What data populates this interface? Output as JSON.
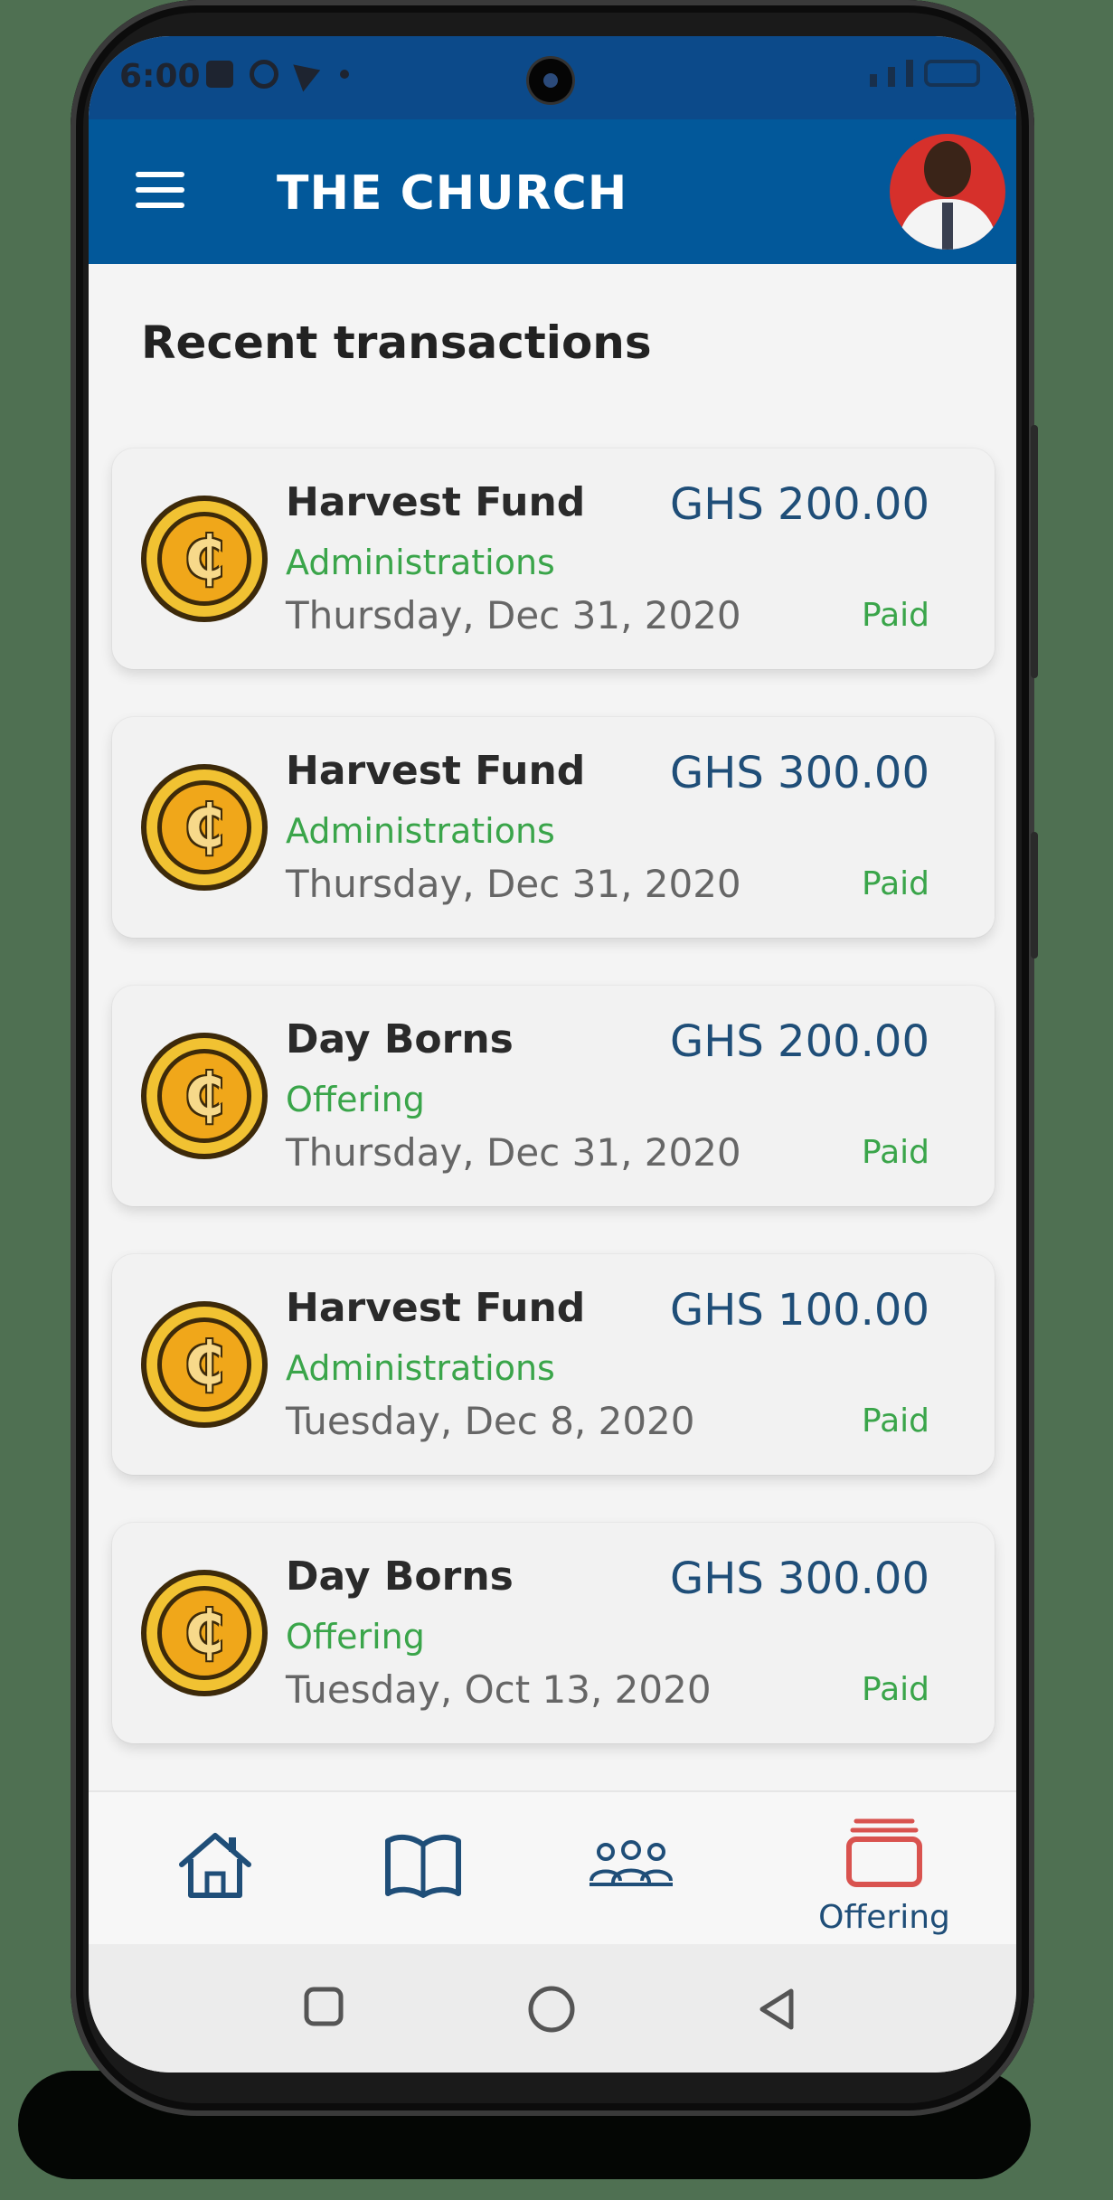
{
  "status_bar": {
    "time": "6:00"
  },
  "app_bar": {
    "title": "THE CHURCH",
    "menu_icon": "hamburger-menu-icon",
    "avatar": "user-avatar"
  },
  "section_title": "Recent transactions",
  "transactions": [
    {
      "title": "Harvest Fund",
      "category": "Administrations",
      "date": "Thursday, Dec 31, 2020",
      "amount": "GHS 200.00",
      "status": "Paid"
    },
    {
      "title": "Harvest Fund",
      "category": "Administrations",
      "date": "Thursday, Dec 31, 2020",
      "amount": "GHS 300.00",
      "status": "Paid"
    },
    {
      "title": "Day Borns",
      "category": "Offering",
      "date": "Thursday, Dec 31, 2020",
      "amount": "GHS 200.00",
      "status": "Paid"
    },
    {
      "title": "Harvest Fund",
      "category": "Administrations",
      "date": "Tuesday, Dec 8, 2020",
      "amount": "GHS 100.00",
      "status": "Paid"
    },
    {
      "title": "Day Borns",
      "category": "Offering",
      "date": "Tuesday, Oct 13, 2020",
      "amount": "GHS 300.00",
      "status": "Paid"
    }
  ],
  "bottom_nav": {
    "items": [
      {
        "icon": "home-icon",
        "label": ""
      },
      {
        "icon": "book-icon",
        "label": ""
      },
      {
        "icon": "people-icon",
        "label": ""
      },
      {
        "icon": "offering-icon",
        "label": "Offering",
        "active": true
      }
    ]
  },
  "colors": {
    "primary": "#02589a",
    "accent_green": "#3aa54a",
    "amount_blue": "#1f4e78",
    "active_red": "#d9534f"
  }
}
